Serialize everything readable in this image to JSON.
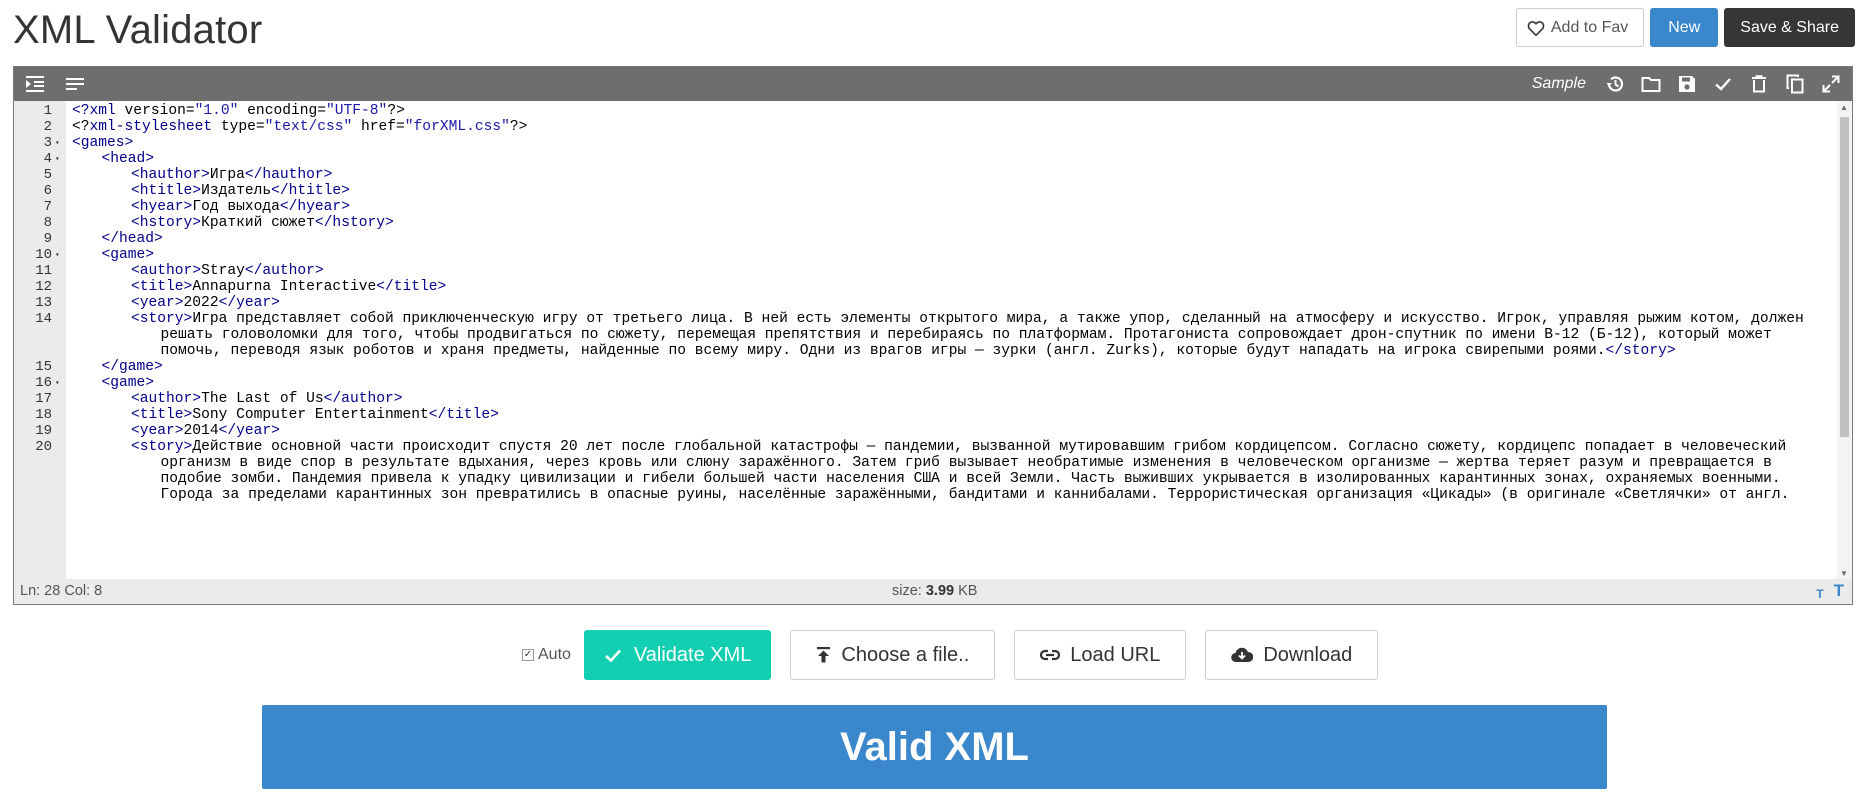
{
  "page": {
    "title": "XML Validator"
  },
  "header": {
    "fav_label": "Add to Fav",
    "new_label": "New",
    "save_label": "Save & Share"
  },
  "toolbar": {
    "sample_label": "Sample"
  },
  "editor": {
    "lines": [
      {
        "n": "1",
        "fold": false,
        "indent": 0,
        "parts": [
          {
            "c": "tag",
            "t": "<?"
          },
          {
            "c": "tag",
            "t": "xml"
          },
          {
            "c": "txt",
            "t": " version="
          },
          {
            "c": "aval",
            "t": "\"1.0\""
          },
          {
            "c": "txt",
            "t": " encoding="
          },
          {
            "c": "aval",
            "t": "\"UTF-8\""
          },
          {
            "c": "txt",
            "t": "?>"
          }
        ]
      },
      {
        "n": "2",
        "fold": false,
        "indent": 0,
        "parts": [
          {
            "c": "txt",
            "t": "<?"
          },
          {
            "c": "tag",
            "t": "xml-stylesheet"
          },
          {
            "c": "txt",
            "t": " type="
          },
          {
            "c": "aval",
            "t": "\"text/css\""
          },
          {
            "c": "txt",
            "t": " href="
          },
          {
            "c": "aval",
            "t": "\"forXML.css\""
          },
          {
            "c": "txt",
            "t": "?>"
          }
        ]
      },
      {
        "n": "3",
        "fold": true,
        "indent": 0,
        "parts": [
          {
            "c": "tag",
            "t": "<games>"
          }
        ]
      },
      {
        "n": "4",
        "fold": true,
        "indent": 1,
        "parts": [
          {
            "c": "tag",
            "t": "<head>"
          }
        ]
      },
      {
        "n": "5",
        "fold": false,
        "indent": 2,
        "parts": [
          {
            "c": "tag",
            "t": "<hauthor>"
          },
          {
            "c": "txt",
            "t": "Игра"
          },
          {
            "c": "tag",
            "t": "</hauthor>"
          }
        ]
      },
      {
        "n": "6",
        "fold": false,
        "indent": 2,
        "parts": [
          {
            "c": "tag",
            "t": "<htitle>"
          },
          {
            "c": "txt",
            "t": "Издатель"
          },
          {
            "c": "tag",
            "t": "</htitle>"
          }
        ]
      },
      {
        "n": "7",
        "fold": false,
        "indent": 2,
        "parts": [
          {
            "c": "tag",
            "t": "<hyear>"
          },
          {
            "c": "txt",
            "t": "Год выхода"
          },
          {
            "c": "tag",
            "t": "</hyear>"
          }
        ]
      },
      {
        "n": "8",
        "fold": false,
        "indent": 2,
        "parts": [
          {
            "c": "tag",
            "t": "<hstory>"
          },
          {
            "c": "txt",
            "t": "Краткий сюжет"
          },
          {
            "c": "tag",
            "t": "</hstory>"
          }
        ]
      },
      {
        "n": "9",
        "fold": false,
        "indent": 1,
        "parts": [
          {
            "c": "tag",
            "t": "</head>"
          }
        ]
      },
      {
        "n": "10",
        "fold": true,
        "indent": 1,
        "parts": [
          {
            "c": "tag",
            "t": "<game>"
          }
        ]
      },
      {
        "n": "11",
        "fold": false,
        "indent": 2,
        "parts": [
          {
            "c": "tag",
            "t": "<author>"
          },
          {
            "c": "txt",
            "t": "Stray"
          },
          {
            "c": "tag",
            "t": "</author>"
          }
        ]
      },
      {
        "n": "12",
        "fold": false,
        "indent": 2,
        "parts": [
          {
            "c": "tag",
            "t": "<title>"
          },
          {
            "c": "txt",
            "t": "Annapurna Interactive"
          },
          {
            "c": "tag",
            "t": "</title>"
          }
        ]
      },
      {
        "n": "13",
        "fold": false,
        "indent": 2,
        "parts": [
          {
            "c": "tag",
            "t": "<year>"
          },
          {
            "c": "txt",
            "t": "2022"
          },
          {
            "c": "tag",
            "t": "</year>"
          }
        ]
      },
      {
        "n": "14",
        "fold": false,
        "indent": 2,
        "parts": [
          {
            "c": "tag",
            "t": "<story>"
          },
          {
            "c": "txt",
            "t": "Игра представляет собой приключенческую игру от третьего лица. В ней есть элементы открытого мира, а также упор, сделанный на атмосферу и искусство. Игрок, управляя рыжим котом, должен"
          }
        ]
      },
      {
        "n": "",
        "fold": false,
        "indent": 3,
        "parts": [
          {
            "c": "txt",
            "t": "решать головоломки для того, чтобы продвигаться по сюжету, перемещая препятствия и перебираясь по платформам. Протагониста сопровождает дрон-спутник по имени B-12 (Б-12), который может"
          }
        ]
      },
      {
        "n": "",
        "fold": false,
        "indent": 3,
        "parts": [
          {
            "c": "txt",
            "t": "помочь, переводя язык роботов и храня предметы, найденные по всему миру. Одни из врагов игры — зурки (англ. Zurks), которые будут нападать на игрока свирепыми роями."
          },
          {
            "c": "tag",
            "t": "</story>"
          }
        ]
      },
      {
        "n": "15",
        "fold": false,
        "indent": 1,
        "parts": [
          {
            "c": "tag",
            "t": "</game>"
          }
        ]
      },
      {
        "n": "16",
        "fold": true,
        "indent": 1,
        "parts": [
          {
            "c": "tag",
            "t": "<game>"
          }
        ]
      },
      {
        "n": "17",
        "fold": false,
        "indent": 2,
        "parts": [
          {
            "c": "tag",
            "t": "<author>"
          },
          {
            "c": "txt",
            "t": "The Last of Us"
          },
          {
            "c": "tag",
            "t": "</author>"
          }
        ]
      },
      {
        "n": "18",
        "fold": false,
        "indent": 2,
        "parts": [
          {
            "c": "tag",
            "t": "<title>"
          },
          {
            "c": "txt",
            "t": "Sony Computer Entertainment"
          },
          {
            "c": "tag",
            "t": "</title>"
          }
        ]
      },
      {
        "n": "19",
        "fold": false,
        "indent": 2,
        "parts": [
          {
            "c": "tag",
            "t": "<year>"
          },
          {
            "c": "txt",
            "t": "2014"
          },
          {
            "c": "tag",
            "t": "</year>"
          }
        ]
      },
      {
        "n": "20",
        "fold": false,
        "indent": 2,
        "parts": [
          {
            "c": "tag",
            "t": "<story>"
          },
          {
            "c": "txt",
            "t": "Действие основной части происходит спустя 20 лет после глобальной катастрофы — пандемии, вызванной мутировавшим грибом кордицепсом. Согласно сюжету, кордицепс попадает в человеческий"
          }
        ]
      },
      {
        "n": "",
        "fold": false,
        "indent": 3,
        "parts": [
          {
            "c": "txt",
            "t": "организм в виде спор в результате вдыхания, через кровь или слюну заражённого. Затем гриб вызывает необратимые изменения в человеческом организме — жертва теряет разум и превращается в"
          }
        ]
      },
      {
        "n": "",
        "fold": false,
        "indent": 3,
        "parts": [
          {
            "c": "txt",
            "t": "подобие зомби. Пандемия привела к упадку цивилизации и гибели большей части населения США и всей Земли. Часть выживших укрывается в изолированных карантинных зонах, охраняемых военными."
          }
        ]
      },
      {
        "n": "",
        "fold": false,
        "indent": 3,
        "parts": [
          {
            "c": "txt",
            "t": "Города за пределами карантинных зон превратились в опасные руины, населённые заражёнными, бандитами и каннибалами. Террористическая организация «Цикады» (в оригинале «Светлячки» от англ."
          }
        ]
      }
    ]
  },
  "status": {
    "position": "Ln: 28 Col: 8",
    "size_label": "size:",
    "size_value": "3.99",
    "size_unit": "KB"
  },
  "actions": {
    "auto_label": "Auto",
    "auto_checked": true,
    "validate_label": "Validate XML",
    "choose_file_label": "Choose a file..",
    "load_url_label": "Load URL",
    "download_label": "Download"
  },
  "result": {
    "label": "Valid XML"
  },
  "colors": {
    "primary": "#3a87cb",
    "validate": "#12cfb1",
    "dark": "#363636",
    "toolbar": "#6e6e6e"
  }
}
